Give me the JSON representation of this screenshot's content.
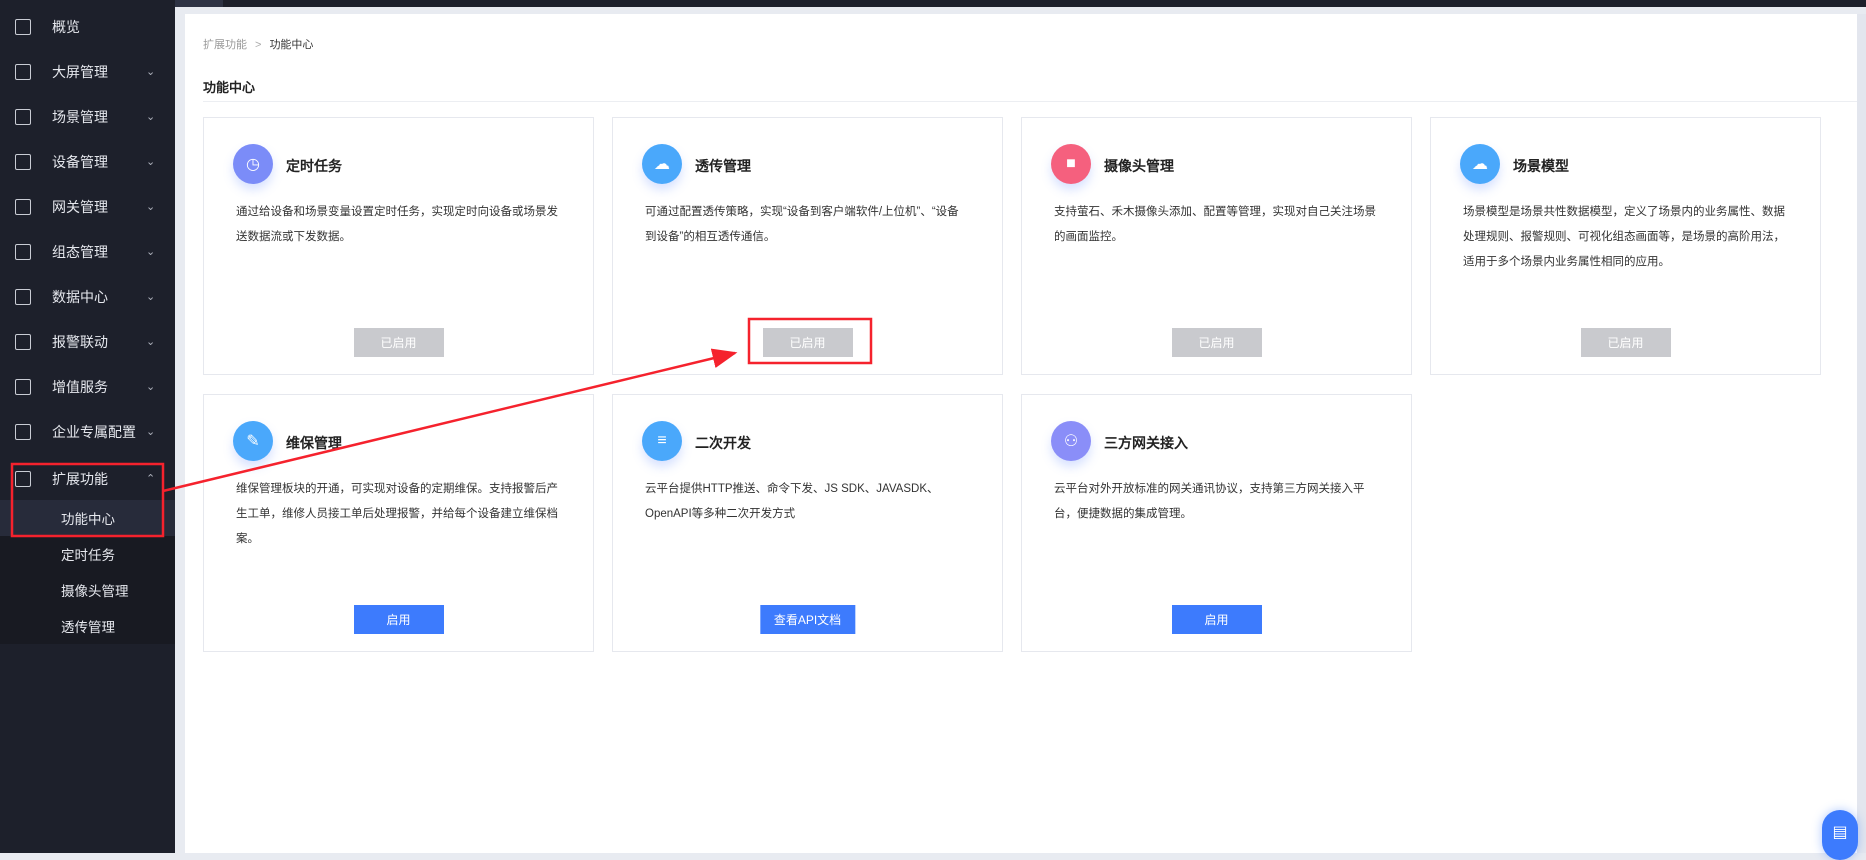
{
  "sidebar": {
    "items": [
      {
        "label": "概览",
        "icon": "overview-icon",
        "chevron": ""
      },
      {
        "label": "大屏管理",
        "icon": "monitor-icon",
        "chevron": "⌄"
      },
      {
        "label": "场景管理",
        "icon": "cube-icon",
        "chevron": "⌄"
      },
      {
        "label": "设备管理",
        "icon": "device-icon",
        "chevron": "⌄"
      },
      {
        "label": "网关管理",
        "icon": "gateway-icon",
        "chevron": "⌄"
      },
      {
        "label": "组态管理",
        "icon": "topology-icon",
        "chevron": "⌄"
      },
      {
        "label": "数据中心",
        "icon": "chart-icon",
        "chevron": "⌄"
      },
      {
        "label": "报警联动",
        "icon": "alarm-icon",
        "chevron": "⌄"
      },
      {
        "label": "增值服务",
        "icon": "diamond-icon",
        "chevron": "⌄"
      },
      {
        "label": "企业专属配置",
        "icon": "building-icon",
        "chevron": "⌄"
      },
      {
        "label": "扩展功能",
        "icon": "grid-icon",
        "chevron": "⌃"
      }
    ],
    "submenu": [
      "功能中心",
      "定时任务",
      "摄像头管理",
      "透传管理"
    ]
  },
  "breadcrumb": {
    "parent": "扩展功能",
    "separator": ">",
    "current": "功能中心"
  },
  "page_title": "功能中心",
  "cards": [
    {
      "title": "定时任务",
      "icon": "clock-icon",
      "color": "#7b8cf8",
      "desc": "通过给设备和场景变量设置定时任务，实现定时向设备或场景发送数据流或下发数据。",
      "button": "已启用",
      "enabled": true
    },
    {
      "title": "透传管理",
      "icon": "cloud-icon",
      "color": "#4aa8fb",
      "desc": "可通过配置透传策略，实现“设备到客户端软件/上位机”、“设备到设备”的相互透传通信。",
      "button": "已启用",
      "enabled": true
    },
    {
      "title": "摄像头管理",
      "icon": "camera-icon",
      "color": "#f5607e",
      "desc": "支持萤石、禾木摄像头添加、配置等管理，实现对自己关注场景的画面监控。",
      "button": "已启用",
      "enabled": true
    },
    {
      "title": "场景模型",
      "icon": "cloud-icon",
      "color": "#4aa8fb",
      "desc": "场景模型是场景共性数据模型，定义了场景内的业务属性、数据处理规则、报警规则、可视化组态画面等，是场景的高阶用法，适用于多个场景内业务属性相同的应用。",
      "button": "已启用",
      "enabled": true
    },
    {
      "title": "维保管理",
      "icon": "wrench-icon",
      "color": "#4aa8fb",
      "desc": "维保管理板块的开通，可实现对设备的定期维保。支持报警后产生工单，维修人员接工单后处理报警，并给每个设备建立维保档案。",
      "button": "启用",
      "enabled": false
    },
    {
      "title": "二次开发",
      "icon": "layers-icon",
      "color": "#4aa8fb",
      "desc": "云平台提供HTTP推送、命令下发、JS SDK、JAVASDK、OpenAPI等多种二次开发方式",
      "button": "查看API文档",
      "enabled": false
    },
    {
      "title": "三方网关接入",
      "icon": "network-icon",
      "color": "#8a8ef8",
      "desc": "云平台对外开放标准的网关通讯协议，支持第三方网关接入平台，便捷数据的集成管理。",
      "button": "启用",
      "enabled": false
    }
  ],
  "fab": {
    "icon": "document-icon"
  },
  "annotation_color": "#f5222d"
}
